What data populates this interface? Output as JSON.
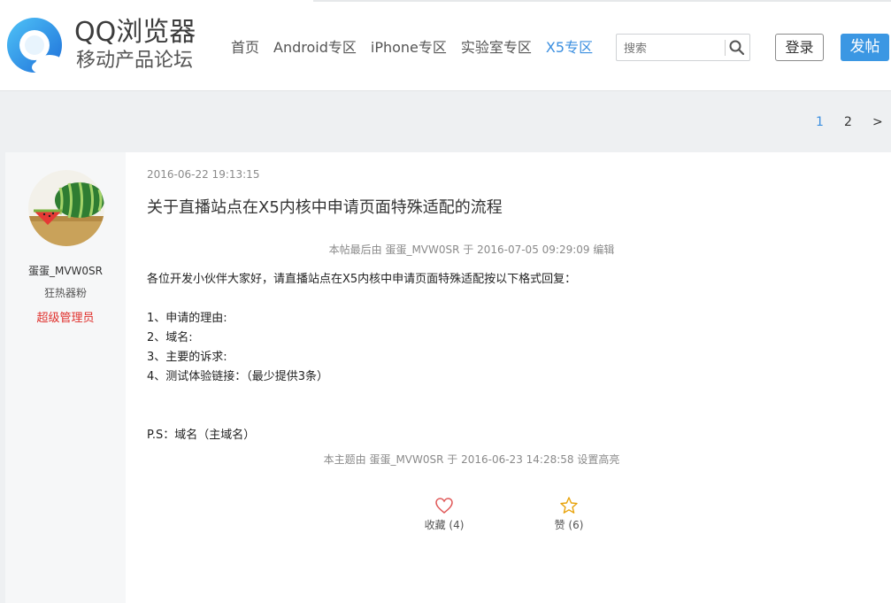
{
  "header": {
    "logo_title": "QQ浏览器",
    "logo_subtitle": "移动产品论坛",
    "nav": [
      "首页",
      "Android专区",
      "iPhone专区",
      "实验室专区",
      "X5专区"
    ],
    "nav_active": "X5专区",
    "search_placeholder": "搜索",
    "login_label": "登录",
    "post_label": "发帖",
    "accent_color": "#3b97e3"
  },
  "pagination": {
    "current": "1",
    "next_page": "2",
    "next_arrow": ">"
  },
  "post": {
    "author": {
      "name": "蛋蛋_MVW0SR",
      "level": "狂热器粉",
      "role": "超级管理员",
      "role_color": "#e0302c"
    },
    "time": "2016-06-22 19:13:15",
    "title": "关于直播站点在X5内核中申请页面特殊适配的流程",
    "edit_note": "本帖最后由 蛋蛋_MVW0SR 于 2016-07-05 09:29:09 编辑",
    "body": [
      "各位开发小伙伴大家好，请直播站点在X5内核中申请页面特殊适配按以下格式回复：",
      "1、申请的理由:",
      "2、域名:",
      "3、主要的诉求:",
      "4、测试体验链接：（最少提供3条）",
      "P.S：域名（主域名）"
    ],
    "highlight_note": "本主题由 蛋蛋_MVW0SR 于 2016-06-23 14:28:58 设置高亮",
    "actions": {
      "favorite_label": "收藏 (4)",
      "like_label": "赞 (6)"
    }
  }
}
